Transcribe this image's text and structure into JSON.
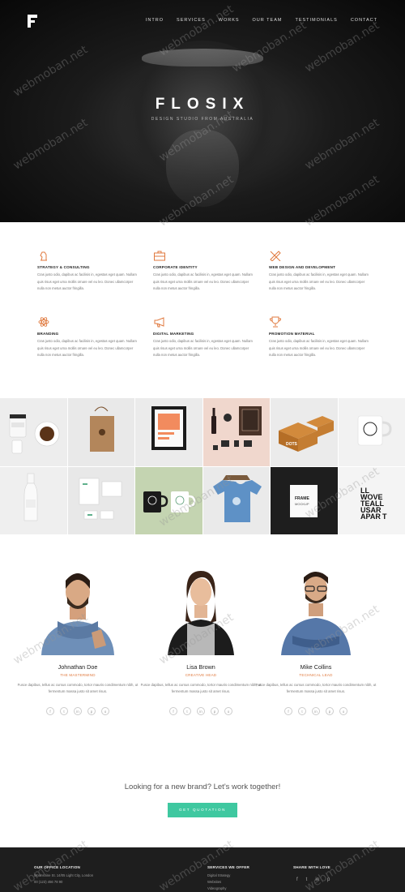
{
  "hero": {
    "brand": "FLOSIX",
    "tagline": "DESIGN STUDIO FROM AUSTRALIA",
    "nav": [
      "INTRO",
      "SERVICES",
      "WORKS",
      "OUR TEAM",
      "TESTIMONIALS",
      "CONTACT"
    ]
  },
  "services": [
    {
      "icon": "knight-icon",
      "title": "STRATEGY & CONSULTING",
      "text": "Cras justo odio, dapibus ac facilisis in, egestas eget quam. Nullam quis risus eget urna mollis ornare vel eu leo. Donec ullamcorper nulla non metus auctor fringilla."
    },
    {
      "icon": "briefcase-icon",
      "title": "CORPORATE IDENTITY",
      "text": "Cras justo odio, dapibus ac facilisis in, egestas eget quam. Nullam quis risus eget urna mollis ornare vel eu leo. Donec ullamcorper nulla non metus auctor fringilla."
    },
    {
      "icon": "pencil-ruler-icon",
      "title": "WEB DESIGN AND DEVELOPMENT",
      "text": "Cras justo odio, dapibus ac facilisis in, egestas eget quam. Nullam quis risus eget urna mollis ornare vel eu leo. Donec ullamcorper nulla non metus auctor fringilla."
    },
    {
      "icon": "atom-icon",
      "title": "BRANDING",
      "text": "Cras justo odio, dapibus ac facilisis in, egestas eget quam. Nullam quis risus eget urna mollis ornare vel eu leo. Donec ullamcorper nulla non metus auctor fringilla."
    },
    {
      "icon": "megaphone-icon",
      "title": "DIGITAL MARKETING",
      "text": "Cras justo odio, dapibus ac facilisis in, egestas eget quam. Nullam quis risus eget urna mollis ornare vel eu leo. Donec ullamcorper nulla non metus auctor fringilla."
    },
    {
      "icon": "trophy-icon",
      "title": "PROMOTION MATERIAL",
      "text": "Cras justo odio, dapibus ac facilisis in, egestas eget quam. Nullam quis risus eget urna mollis ornare vel eu leo. Donec ullamcorper nulla non metus auctor fringilla."
    }
  ],
  "portfolio": {
    "tiles": [
      "jars-and-coffee",
      "paper-bag",
      "framed-poster",
      "wine-and-stationery",
      "donut-boxes",
      "mug",
      "white-bottle",
      "business-cards",
      "mugs",
      "t-shirt",
      "frame-mockup",
      "typography-poster"
    ],
    "poster_text": [
      "LL",
      "WOVE",
      "TEALL",
      "USAR",
      "APAR",
      "T"
    ],
    "dots_text": "DOTS",
    "frame_text": "FRAME",
    "mockup_text": "MOCKUP"
  },
  "team": [
    {
      "name": "Johnathan Doe",
      "role": "THE MASTERMIND",
      "bio": "Fusce dapibus, tellus ac cursus commodo, tortor mauris condimentum nibh, ut fermentum massa justo sit amet risus."
    },
    {
      "name": "Lisa Brown",
      "role": "CREATIVE HEAD",
      "bio": "Fusce dapibus, tellus ac cursus commodo, tortor mauris condimentum nibh, ut fermentum massa justo sit amet risus."
    },
    {
      "name": "Mike Collins",
      "role": "TECHNICAL LEAD",
      "bio": "Fusce dapibus, tellus ac cursus commodo, tortor mauris condimentum nibh, ut fermentum massa justo sit amet risus."
    }
  ],
  "social_icons": [
    "f",
    "t",
    "in",
    "p",
    "o"
  ],
  "cta": {
    "text": "Looking for a new brand? Let's work together!",
    "button": "GET QUOTATION"
  },
  "footer": {
    "office_title": "OUR OFFICE LOCATION",
    "office_lines": [
      "Moonshine St. 14/05 Light City, London",
      "00 (123) 456 78 90"
    ],
    "services_title": "SERVICES WE OFFER",
    "services_items": [
      "Digital Strategy",
      "Websites",
      "Videography"
    ],
    "share_title": "SHARE WITH LOVE",
    "share_icons": [
      "f",
      "t",
      "in",
      "p"
    ]
  },
  "watermark": "webmoban.net",
  "colors": {
    "accent": "#e07a3f",
    "cta": "#3fc8a0",
    "footer": "#1e1e1e"
  }
}
